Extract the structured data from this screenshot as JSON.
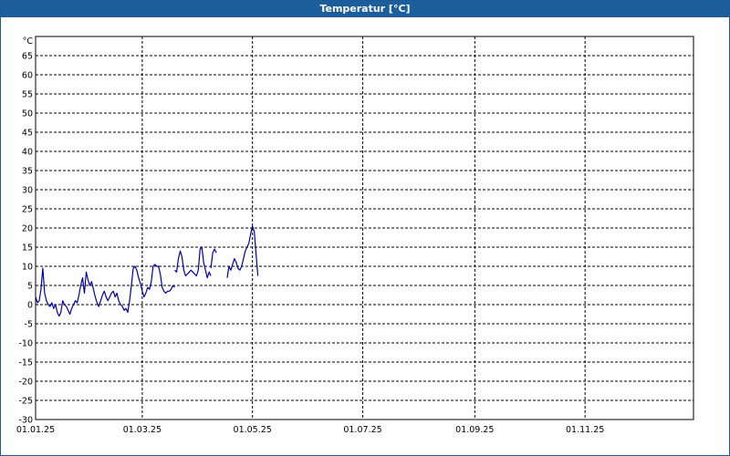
{
  "window": {
    "title": "Temperatur [°C]"
  },
  "chart_data": {
    "type": "line",
    "title": "Temperatur [°C]",
    "ylabel": "°C",
    "xlabel": "",
    "ylim": [
      -30,
      70
    ],
    "yticks": [
      65,
      60,
      55,
      50,
      45,
      40,
      35,
      30,
      25,
      20,
      15,
      10,
      5,
      0,
      -5,
      -10,
      -15,
      -20,
      -25,
      -30
    ],
    "xlim": [
      "2025-01-01",
      "2025-12-31"
    ],
    "xticks": [
      {
        "date": "2025-01-01",
        "label": "01.01.25"
      },
      {
        "date": "2025-03-01",
        "label": "01.03.25"
      },
      {
        "date": "2025-05-01",
        "label": "01.05.25"
      },
      {
        "date": "2025-07-01",
        "label": "01.07.25"
      },
      {
        "date": "2025-09-01",
        "label": "01.09.25"
      },
      {
        "date": "2025-11-01",
        "label": "01.11.25"
      }
    ],
    "vgrid_dates": [
      "2025-03-01",
      "2025-05-01",
      "2025-07-01",
      "2025-09-01",
      "2025-11-01",
      "2025-12-31"
    ],
    "grid": true,
    "series_color": "#0000aa",
    "series": [
      {
        "segments": [
          [
            [
              "2025-01-01",
              2
            ],
            [
              "2025-01-02",
              0.5
            ],
            [
              "2025-01-03",
              1
            ],
            [
              "2025-01-04",
              4
            ],
            [
              "2025-01-05",
              9.5
            ],
            [
              "2025-01-06",
              3
            ],
            [
              "2025-01-07",
              1
            ],
            [
              "2025-01-08",
              0
            ],
            [
              "2025-01-09",
              -0.5
            ],
            [
              "2025-01-10",
              0.5
            ],
            [
              "2025-01-11",
              -1
            ],
            [
              "2025-01-12",
              0
            ],
            [
              "2025-01-13",
              -2
            ],
            [
              "2025-01-14",
              -3
            ],
            [
              "2025-01-15",
              -2
            ],
            [
              "2025-01-16",
              1
            ],
            [
              "2025-01-17",
              0
            ],
            [
              "2025-01-18",
              -0.5
            ],
            [
              "2025-01-19",
              -1.5
            ],
            [
              "2025-01-20",
              -2.5
            ],
            [
              "2025-01-21",
              -1
            ],
            [
              "2025-01-22",
              0
            ],
            [
              "2025-01-23",
              1
            ],
            [
              "2025-01-24",
              0.5
            ],
            [
              "2025-01-25",
              2.5
            ],
            [
              "2025-01-26",
              5
            ],
            [
              "2025-01-27",
              7
            ],
            [
              "2025-01-28",
              3
            ],
            [
              "2025-01-29",
              8.5
            ],
            [
              "2025-01-30",
              6.5
            ],
            [
              "2025-01-31",
              5
            ],
            [
              "2025-02-01",
              6
            ],
            [
              "2025-02-02",
              4
            ],
            [
              "2025-02-03",
              2
            ],
            [
              "2025-02-04",
              0.5
            ],
            [
              "2025-02-05",
              -0.5
            ],
            [
              "2025-02-06",
              1
            ],
            [
              "2025-02-07",
              2.5
            ],
            [
              "2025-02-08",
              3.5
            ],
            [
              "2025-02-09",
              2
            ],
            [
              "2025-02-10",
              1
            ],
            [
              "2025-02-11",
              2
            ],
            [
              "2025-02-12",
              3
            ],
            [
              "2025-02-13",
              3.5
            ],
            [
              "2025-02-14",
              2
            ],
            [
              "2025-02-15",
              3
            ],
            [
              "2025-02-16",
              1
            ],
            [
              "2025-02-17",
              0
            ],
            [
              "2025-02-18",
              -0.5
            ],
            [
              "2025-02-19",
              -1.5
            ],
            [
              "2025-02-20",
              -1
            ],
            [
              "2025-02-21",
              -2
            ],
            [
              "2025-02-22",
              1
            ],
            [
              "2025-02-23",
              5
            ],
            [
              "2025-02-24",
              9.5
            ],
            [
              "2025-02-25",
              10
            ],
            [
              "2025-02-26",
              9
            ],
            [
              "2025-02-27",
              7
            ],
            [
              "2025-02-28",
              5.5
            ],
            [
              "2025-03-01",
              3.5
            ],
            [
              "2025-03-02",
              2
            ],
            [
              "2025-03-03",
              3
            ],
            [
              "2025-03-04",
              4.5
            ],
            [
              "2025-03-05",
              4
            ],
            [
              "2025-03-06",
              6
            ],
            [
              "2025-03-07",
              10
            ],
            [
              "2025-03-08",
              10.5
            ],
            [
              "2025-03-09",
              10
            ],
            [
              "2025-03-10",
              10
            ],
            [
              "2025-03-11",
              8
            ],
            [
              "2025-03-12",
              4.5
            ],
            [
              "2025-03-13",
              3.5
            ],
            [
              "2025-03-14",
              3
            ],
            [
              "2025-03-15",
              3.5
            ],
            [
              "2025-03-16",
              3.5
            ],
            [
              "2025-03-17",
              4
            ],
            [
              "2025-03-18",
              5
            ],
            [
              "2025-03-19",
              4.5
            ]
          ],
          [
            [
              "2025-03-19",
              9
            ],
            [
              "2025-03-20",
              8.5
            ],
            [
              "2025-03-21",
              12
            ],
            [
              "2025-03-22",
              14
            ],
            [
              "2025-03-23",
              12.5
            ],
            [
              "2025-03-24",
              9
            ],
            [
              "2025-03-25",
              7.5
            ],
            [
              "2025-03-26",
              8
            ],
            [
              "2025-03-27",
              8.5
            ],
            [
              "2025-03-28",
              9
            ],
            [
              "2025-03-29",
              8.5
            ],
            [
              "2025-03-30",
              8
            ],
            [
              "2025-03-31",
              7.5
            ],
            [
              "2025-04-01",
              9
            ],
            [
              "2025-04-02",
              14.5
            ],
            [
              "2025-04-03",
              15
            ],
            [
              "2025-04-04",
              11
            ],
            [
              "2025-04-05",
              9
            ],
            [
              "2025-04-06",
              7
            ],
            [
              "2025-04-07",
              8.5
            ],
            [
              "2025-04-08",
              7.5
            ]
          ],
          [
            [
              "2025-04-08",
              9.5
            ],
            [
              "2025-04-09",
              13.5
            ],
            [
              "2025-04-10",
              14.5
            ],
            [
              "2025-04-11",
              13.5
            ]
          ],
          [
            [
              "2025-04-17",
              7
            ],
            [
              "2025-04-18",
              10
            ],
            [
              "2025-04-19",
              9
            ],
            [
              "2025-04-20",
              10.5
            ],
            [
              "2025-04-21",
              12
            ],
            [
              "2025-04-22",
              11
            ],
            [
              "2025-04-23",
              9.5
            ],
            [
              "2025-04-24",
              9
            ],
            [
              "2025-04-25",
              10
            ],
            [
              "2025-04-26",
              12
            ],
            [
              "2025-04-27",
              14
            ],
            [
              "2025-04-28",
              15
            ],
            [
              "2025-04-29",
              16
            ],
            [
              "2025-04-30",
              18.5
            ],
            [
              "2025-05-01",
              20.5
            ],
            [
              "2025-05-02",
              19
            ],
            [
              "2025-05-03",
              13
            ],
            [
              "2025-05-04",
              7.5
            ]
          ]
        ]
      }
    ]
  }
}
